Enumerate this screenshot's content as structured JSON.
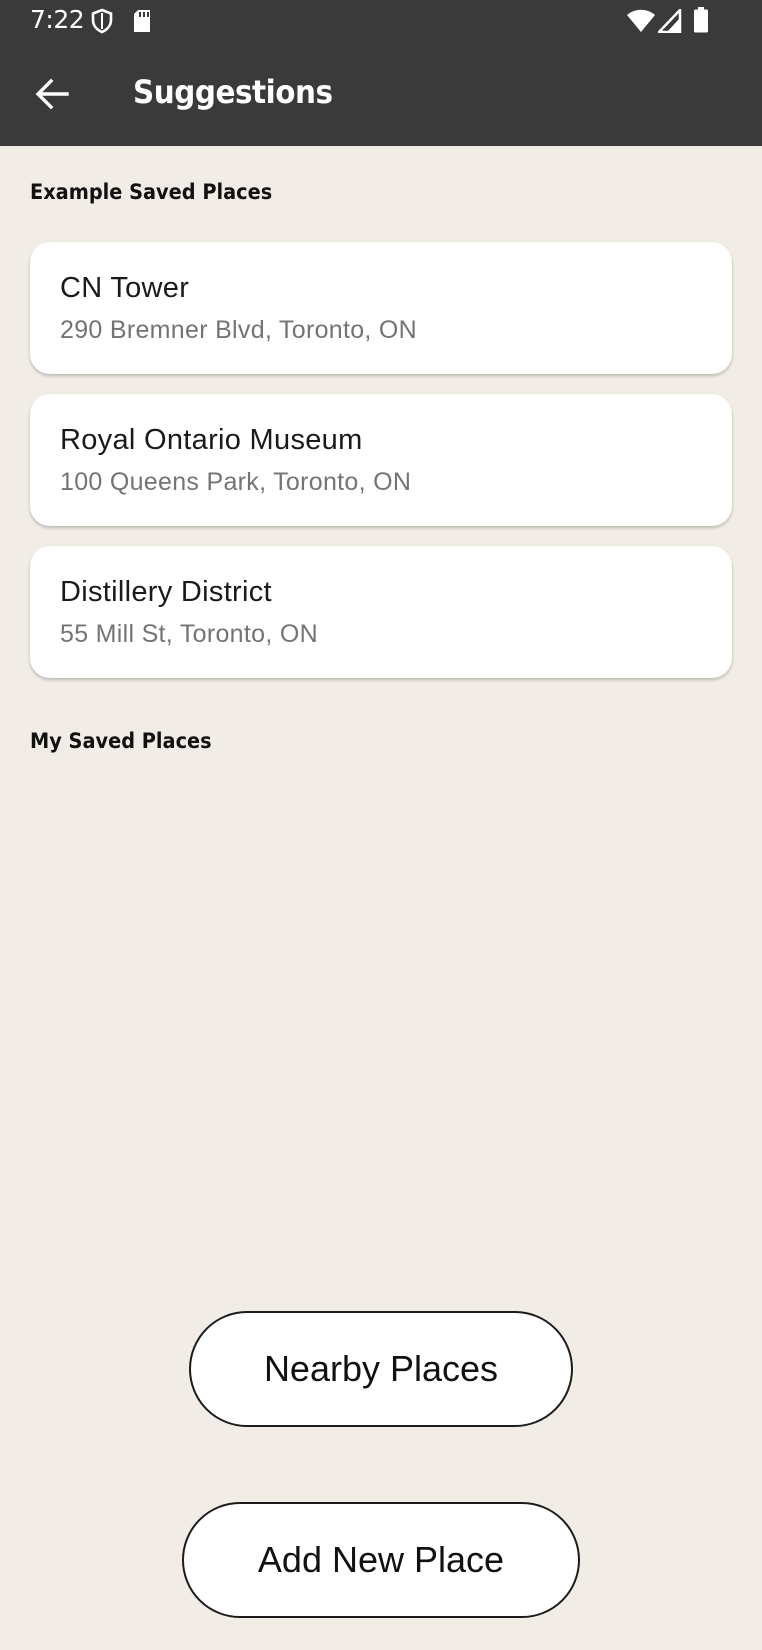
{
  "status_bar": {
    "time": "7:22",
    "icons": [
      "shield-icon",
      "sd-card-icon",
      "wifi-icon",
      "signal-icon",
      "battery-icon"
    ]
  },
  "app_bar": {
    "title": "Suggestions",
    "back_icon": "arrow-left-icon"
  },
  "sections": {
    "example_header": "Example Saved Places",
    "my_header": "My Saved Places"
  },
  "example_places": [
    {
      "name": "CN Tower",
      "address": "290 Bremner Blvd, Toronto, ON"
    },
    {
      "name": "Royal Ontario Museum",
      "address": "100 Queens Park, Toronto, ON"
    },
    {
      "name": "Distillery District",
      "address": "55 Mill St, Toronto, ON"
    }
  ],
  "my_places": [],
  "buttons": {
    "nearby": "Nearby Places",
    "add_new": "Add New Place"
  },
  "colors": {
    "app_bar": "#3a3a3a",
    "background": "#f2ece6",
    "card": "#ffffff",
    "secondary_text": "#747474"
  }
}
